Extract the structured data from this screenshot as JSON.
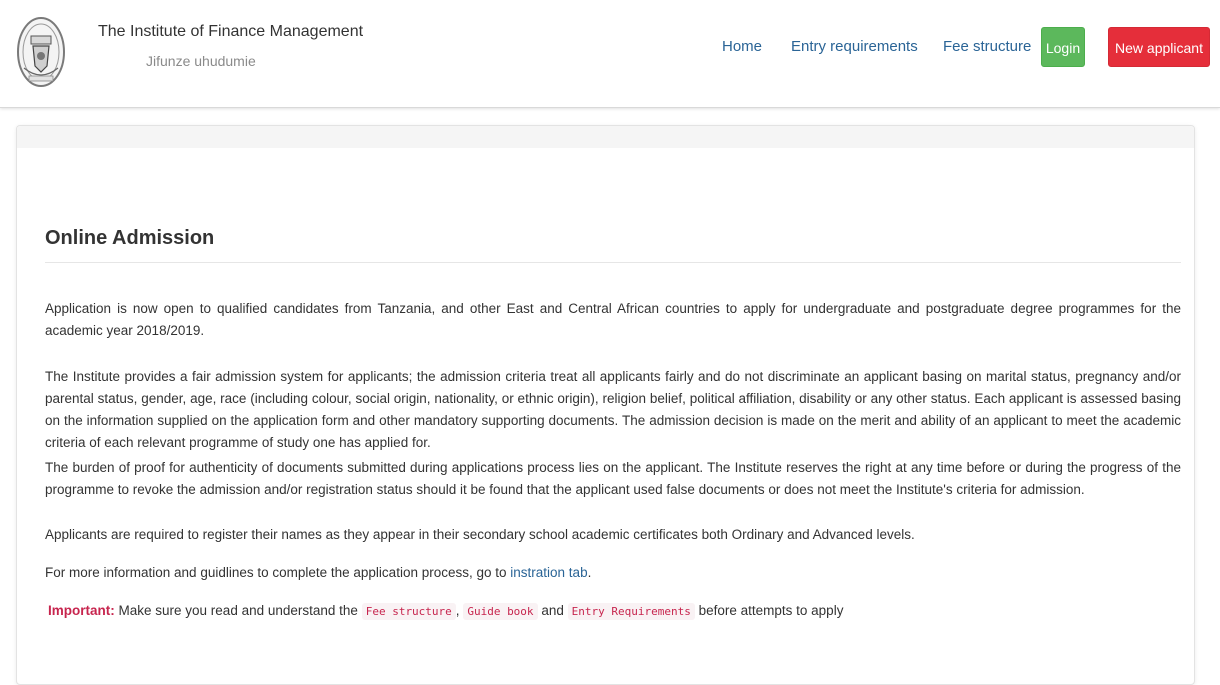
{
  "header": {
    "logo_icon": "institute-crest-icon",
    "title": "The Institute of Finance Management",
    "motto": "Jifunze uhudumie"
  },
  "nav": {
    "home": "Home",
    "entry_requirements": "Entry requirements",
    "fee_structure": "Fee structure",
    "login": "Login",
    "new_applicant": "New applicant"
  },
  "colors": {
    "login_button": "#5cb85c",
    "new_applicant_button": "#e52e3a",
    "link": "#2a6496",
    "code_text": "#c7254e"
  },
  "main": {
    "title": "Online Admission",
    "paragraphs": [
      "Application is now open to qualified candidates from Tanzania, and other East and Central African countries to apply for undergraduate and postgraduate degree programmes for the academic year 2018/2019.",
      "The Institute provides a fair admission system for applicants; the admission criteria treat all applicants fairly and do not discriminate an applicant basing on marital status, pregnancy and/or parental status, gender, age, race (including colour, social origin, nationality, or ethnic origin), religion belief, political affiliation, disability or any other status. Each applicant is assessed basing on the information supplied on the application form and other mandatory supporting documents. The admission decision is made on the merit and ability of an applicant to meet the academic criteria of each relevant programme of study one has applied for.",
      "The burden of proof for authenticity of documents submitted during applications process lies on the applicant. The Institute reserves the right at any time before or during the progress of the programme to revoke the admission and/or registration status should it be found that the applicant used false documents or does not meet the Institute's criteria for admission.",
      "Applicants are required to register their names as they appear in their secondary school academic certificates both Ordinary and Advanced levels."
    ],
    "info_prefix": "For more information and guidlines to complete the application process, go to",
    "info_link": "instration tab",
    "info_suffix": ".",
    "important_label": "Important:",
    "important_text": "Make sure you read and understand the",
    "important_fee": "Fee structure",
    "important_comma": ",",
    "important_guide": "Guide book",
    "important_and": "and",
    "important_entry": "Entry Requirements",
    "important_end": "before attempts to apply"
  }
}
